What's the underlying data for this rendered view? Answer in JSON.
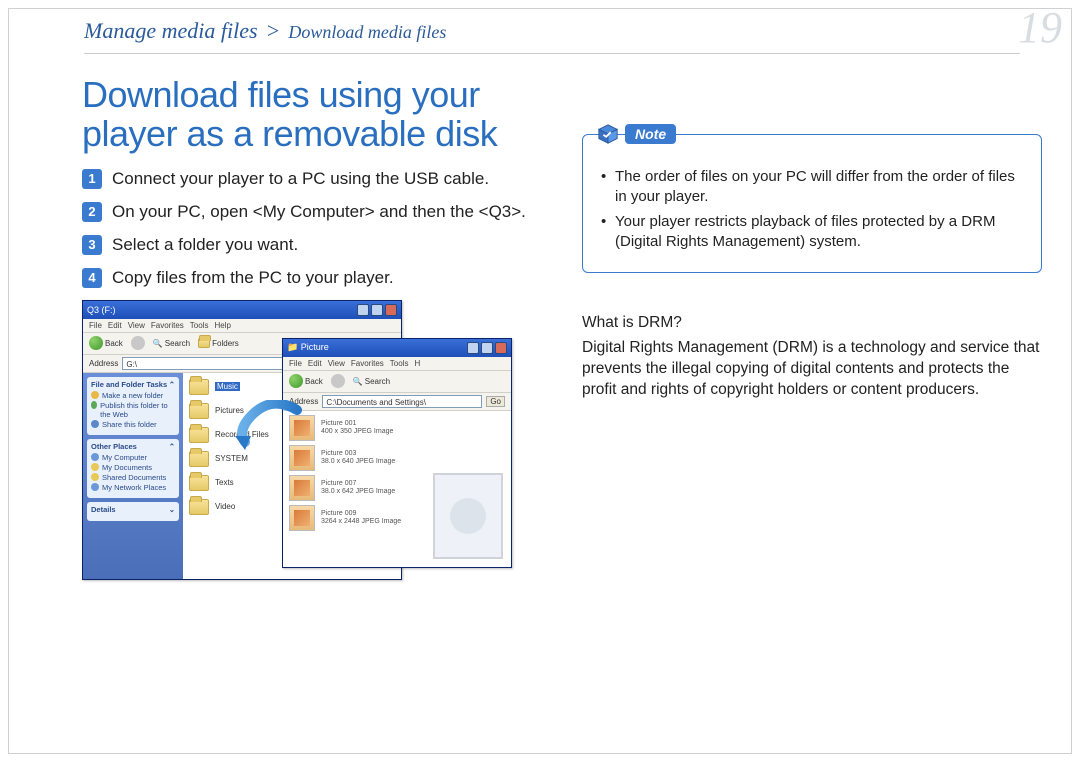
{
  "page_number": "19",
  "breadcrumb": {
    "primary": "Manage media files",
    "separator": ">",
    "secondary": "Download media files"
  },
  "heading": "Download files using your player as a removable disk",
  "steps": [
    "Connect your player to a PC using the USB cable.",
    "On your PC, open <My Computer> and then the <Q3>.",
    "Select a folder you want.",
    "Copy files from the PC to your player."
  ],
  "note": {
    "label": "Note",
    "items": [
      "The order of files on your PC will differ from the order of files in your player.",
      "Your player restricts playback of files protected by a DRM (Digital Rights Management) system."
    ]
  },
  "drm": {
    "question": "What is DRM?",
    "answer": "Digital Rights Management (DRM) is a technology and service that prevents the illegal copying of digital contents and protects the profit and rights of copyright holders or content producers."
  },
  "figure": {
    "win1": {
      "title": "Q3 (F:)",
      "menu": [
        "File",
        "Edit",
        "View",
        "Favorites",
        "Tools",
        "Help"
      ],
      "toolbar": {
        "back": "Back",
        "search": "Search",
        "folders": "Folders"
      },
      "address_label": "Address",
      "address_value": "G:\\",
      "side": {
        "tasks_header": "File and Folder Tasks",
        "tasks": [
          "Make a new folder",
          "Publish this folder to the Web",
          "Share this folder"
        ],
        "other_header": "Other Places",
        "other": [
          "My Computer",
          "My Documents",
          "Shared Documents",
          "My Network Places"
        ],
        "details_header": "Details"
      },
      "folders": [
        "Music",
        "Pictures",
        "Recorded Files",
        "SYSTEM",
        "Texts",
        "Video"
      ]
    },
    "win2": {
      "title": "Picture",
      "menu": [
        "File",
        "Edit",
        "View",
        "Favorites",
        "Tools",
        "H"
      ],
      "toolbar": {
        "back": "Back",
        "search": "Search"
      },
      "address_label": "Address",
      "address_value": "C:\\Documents and Settings\\",
      "go": "Go",
      "thumbs": [
        {
          "name": "Picture 001",
          "meta": "400 x 350\nJPEG Image"
        },
        {
          "name": "Picture 003",
          "meta": "38.0 x 640\nJPEG Image"
        },
        {
          "name": "Picture 007",
          "meta": "38.0 x 642\nJPEG Image"
        },
        {
          "name": "Picture 009",
          "meta": "3264 x 2448\nJPEG Image"
        }
      ]
    }
  }
}
